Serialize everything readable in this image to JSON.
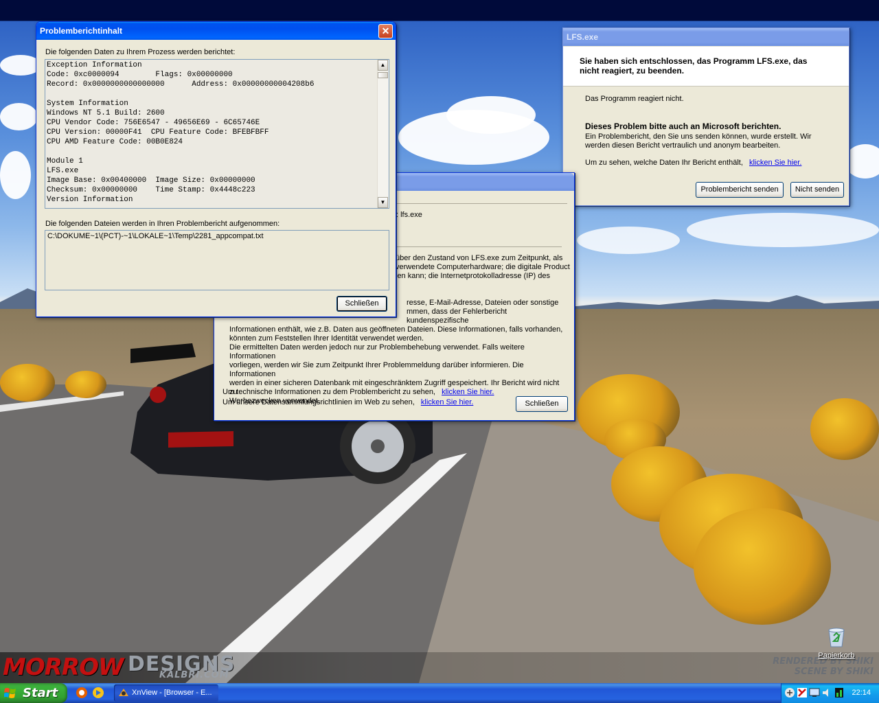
{
  "desktop": {
    "wallpaper": {
      "brand_main": "MORROW",
      "brand_designs": "DESIGNS",
      "brand_url": "KALBRI.COM",
      "credit_line1": "RENDERED BY SHIKI",
      "credit_line2": "SCENE BY SHIKI"
    },
    "icons": [
      {
        "label": "Papierkorb",
        "icon": "recycle-bin-icon"
      }
    ]
  },
  "details_dialog": {
    "title": "Problemberichtinhalt",
    "process_data_label": "Die folgenden Daten zu Ihrem Prozess werden berichtet:",
    "report_lines": [
      "Exception Information",
      "Code: 0xc0000094        Flags: 0x00000000",
      "Record: 0x0000000000000000      Address: 0x00000000004208b6",
      "",
      "System Information",
      "Windows NT 5.1 Build: 2600",
      "CPU Vendor Code: 756E6547 - 49656E69 - 6C65746E",
      "CPU Version: 00000F41  CPU Feature Code: BFEBFBFF",
      "CPU AMD Feature Code: 00B0E824",
      "",
      "Module 1",
      "LFS.exe",
      "Image Base: 0x00400000  Image Size: 0x00000000",
      "Checksum: 0x00000000    Time Stamp: 0x4448c223",
      "Version Information"
    ],
    "files_label": "Die folgenden Dateien werden in Ihren Problembericht aufgenommen:",
    "files": [
      "C:\\DOKUME~1\\(PCT)-~1\\LOKALE~1\\Temp\\2281_appcompat.txt"
    ],
    "close_label": "Schließen"
  },
  "info_dialog": {
    "title": "",
    "app_field": ": lfs.exe",
    "paragraph1_lines": [
      "über den Zustand von LFS.exe zum Zeitpunkt, als",
      "verwendete Computerhardware; die digitale Product",
      "len kann; die Internetprotokolladresse (IP) des"
    ],
    "paragraph2_lines": [
      "resse, E-Mail-Adresse, Dateien oder sonstige",
      "mmen, dass der Fehlerbericht kundenspezifische",
      "Informationen enthält, wie z.B. Daten aus geöffneten Dateien. Diese Informationen, falls vorhanden,",
      "könnten zum Feststellen Ihrer Identität verwendet werden."
    ],
    "paragraph3_lines": [
      "Die ermittelten Daten werden jedoch nur zur Problembehebung verwendet. Falls weitere Informationen",
      "vorliegen, werden wir Sie zum Zeitpunkt Ihrer Problemmeldung darüber informieren. Die Informationen",
      "werden in einer sicheren Datenbank mit eingeschränktem Zugriff gespeichert. Ihr Bericht wird nicht zu",
      "Werbezwecken verwendet."
    ],
    "tech_info_text": "Um technische Informationen zu dem Problembericht zu sehen,",
    "tech_info_link": "klicken Sie hier.",
    "policy_text": "Um unsere Datensammlungsrichtlinien im Web zu sehen,",
    "policy_link": "klicken Sie hier.",
    "close_label": "Schließen"
  },
  "lfs_dialog": {
    "title": "LFS.exe",
    "header_line1": "Sie haben sich entschlossen, das Programm LFS.exe, das",
    "header_line2": "nicht reagiert, zu beenden.",
    "status": "Das Programm reagiert nicht.",
    "report_heading": "Dieses Problem bitte auch an Microsoft berichten.",
    "report_line1": "Ein Problembericht, den Sie uns senden können, wurde erstellt. Wir",
    "report_line2": "werden diesen Bericht vertraulich und anonym bearbeiten.",
    "see_data_text": "Um zu sehen, welche Daten Ihr Bericht enthält,",
    "see_data_link": "klicken Sie hier.",
    "send_label": "Problembericht senden",
    "dont_send_label": "Nicht senden"
  },
  "taskbar": {
    "start_label": "Start",
    "quick_launch": [
      "firefox-icon",
      "media-icon"
    ],
    "tasks": [
      {
        "label": "XnView - [Browser - E...",
        "icon": "xnview-icon",
        "active": true
      }
    ],
    "tray_icons": [
      "network-icon",
      "shield-icon",
      "display-icon",
      "sound-icon",
      "meter-icon"
    ],
    "clock": "22:14"
  },
  "colors": {
    "xp_blue": "#0053ee",
    "dialog_face": "#ece9d8",
    "link": "#0000ee",
    "start_green": "#32a232"
  }
}
